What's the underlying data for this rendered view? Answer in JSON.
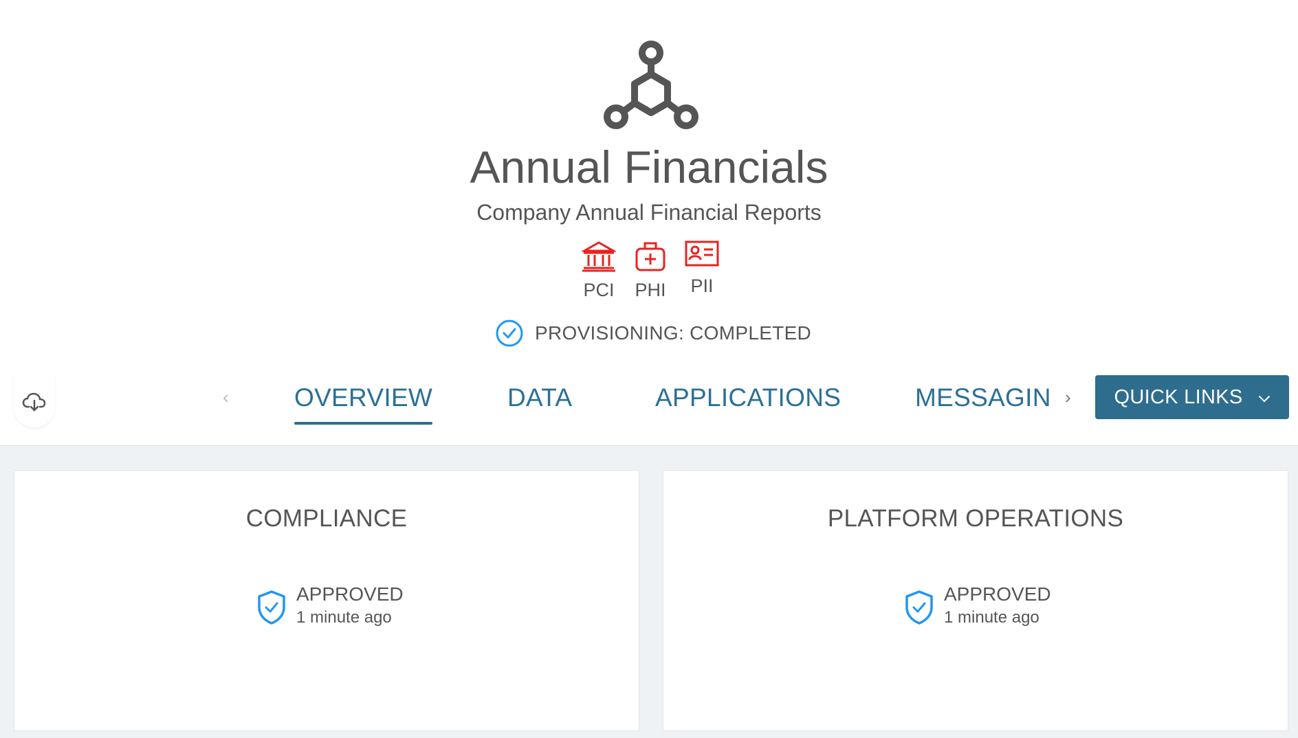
{
  "header": {
    "icon": "hub-network-icon",
    "title": "Annual Financials",
    "subtitle": "Company Annual Financial Reports",
    "tags": [
      {
        "label": "PCI",
        "icon": "bank-icon"
      },
      {
        "label": "PHI",
        "icon": "medical-bag-icon"
      },
      {
        "label": "PII",
        "icon": "id-card-icon"
      }
    ],
    "status": {
      "icon": "check-circle-icon",
      "text": "PROVISIONING: COMPLETED"
    }
  },
  "nav": {
    "download_icon": "cloud-download-icon",
    "prev_icon": "chevron-left-icon",
    "next_icon": "chevron-right-icon",
    "tabs": [
      {
        "label": "OVERVIEW",
        "active": true
      },
      {
        "label": "DATA",
        "active": false
      },
      {
        "label": "APPLICATIONS",
        "active": false
      },
      {
        "label": "MESSAGING",
        "active": false
      }
    ],
    "quick_links": {
      "label": "QUICK LINKS",
      "icon": "chevron-down-icon"
    }
  },
  "cards": [
    {
      "title": "COMPLIANCE",
      "status": "APPROVED",
      "time": "1 minute ago",
      "icon": "shield-check-icon"
    },
    {
      "title": "PLATFORM OPERATIONS",
      "status": "APPROVED",
      "time": "1 minute ago",
      "icon": "shield-check-icon"
    }
  ],
  "colors": {
    "accent": "#2a7096",
    "button": "#2e6d8e",
    "tag_red": "#e8231f",
    "status_blue": "#2196f3",
    "text": "#555555",
    "background": "#eff2f5"
  }
}
